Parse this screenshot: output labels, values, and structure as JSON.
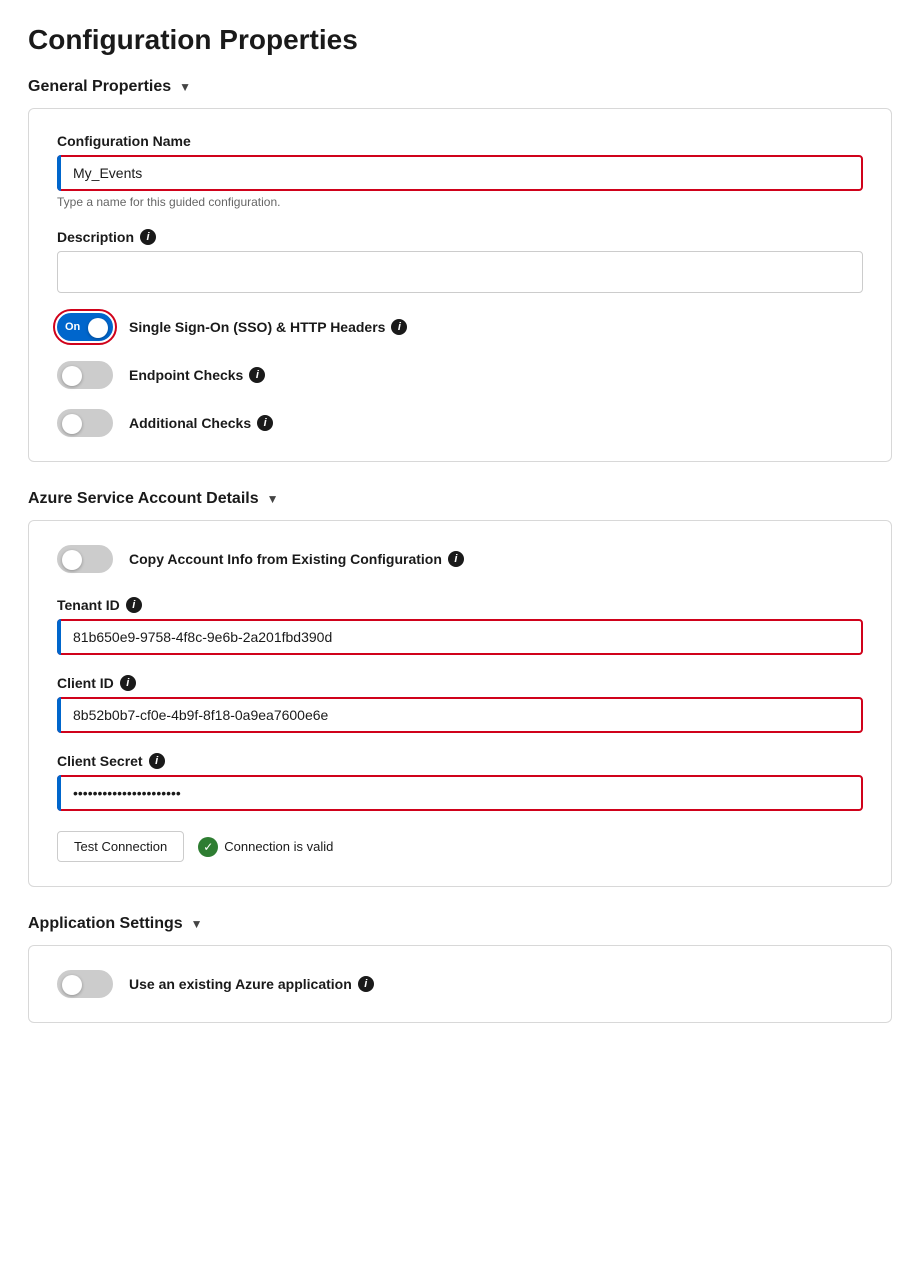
{
  "page": {
    "title": "Configuration Properties"
  },
  "general_properties": {
    "section_label": "General Properties",
    "chevron": "▼",
    "config_name": {
      "label": "Configuration Name",
      "value": "My_Events",
      "hint": "Type a name for this guided configuration."
    },
    "description": {
      "label": "Description",
      "value": ""
    },
    "sso_toggle": {
      "label": "Single Sign-On (SSO) & HTTP Headers",
      "state": "on",
      "text": "On"
    },
    "endpoint_checks": {
      "label": "Endpoint Checks",
      "state": "off"
    },
    "additional_checks": {
      "label": "Additional Checks",
      "state": "off"
    }
  },
  "azure_service": {
    "section_label": "Azure Service Account Details",
    "chevron": "▼",
    "copy_account": {
      "label": "Copy Account Info from Existing Configuration",
      "state": "off"
    },
    "tenant_id": {
      "label": "Tenant ID",
      "value": "81b650e9-9758-4f8c-9e6b-2a201fbd390d"
    },
    "client_id": {
      "label": "Client ID",
      "value": "8b52b0b7-cf0e-4b9f-8f18-0a9ea7600e6e"
    },
    "client_secret": {
      "label": "Client Secret",
      "value": "••••••••••••••••••••••••••••"
    },
    "test_btn_label": "Test Connection",
    "connection_valid_text": "Connection is valid"
  },
  "application_settings": {
    "section_label": "Application Settings",
    "chevron": "▼",
    "use_existing": {
      "label": "Use an existing Azure application",
      "state": "off"
    }
  },
  "icons": {
    "info": "i",
    "check": "✓",
    "chevron_down": "▼"
  }
}
